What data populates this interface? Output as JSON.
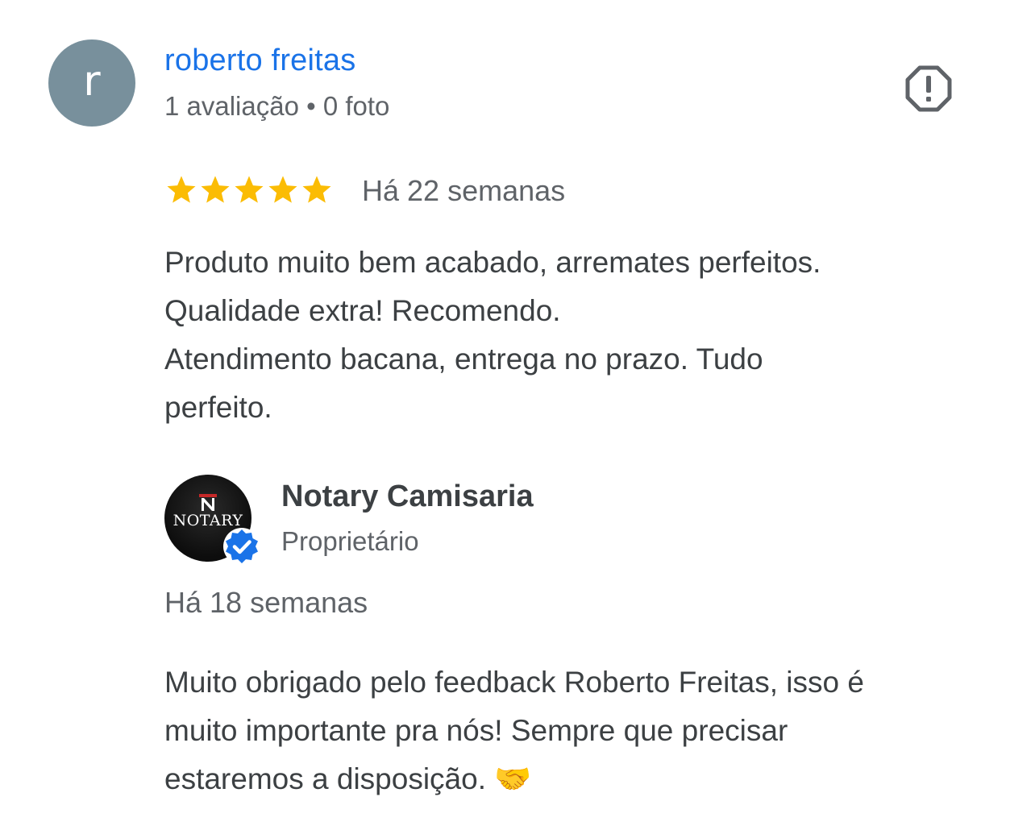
{
  "reviewer": {
    "avatar_letter": "r",
    "name": "roberto freitas",
    "meta": "1 avaliação • 0 foto",
    "report_icon": "report-octagon-icon"
  },
  "review": {
    "rating": 5,
    "rating_max": 5,
    "star_color": "#fbbc04",
    "date": "Há 22 semanas",
    "text_lines": [
      "Produto muito bem acabado, arremates perfeitos.",
      "Qualidade extra! Recomendo.",
      "Atendimento bacana, entrega no prazo. Tudo",
      "perfeito."
    ]
  },
  "owner_response": {
    "logo_text": "NOTARY",
    "name": "Notary Camisaria",
    "role": "Proprietário",
    "verified_icon": "verified-badge-icon",
    "date": "Há 18 semanas",
    "text_lines": [
      "Muito obrigado pelo feedback Roberto Freitas, isso é",
      "muito importante pra nós! Sempre que precisar",
      "estaremos a disposição. "
    ],
    "emoji": "🤝"
  },
  "colors": {
    "link": "#1a73e8",
    "secondary_text": "#5f6368",
    "primary_text": "#3c4043",
    "avatar_bg": "#78909c",
    "verified": "#1a73e8"
  }
}
